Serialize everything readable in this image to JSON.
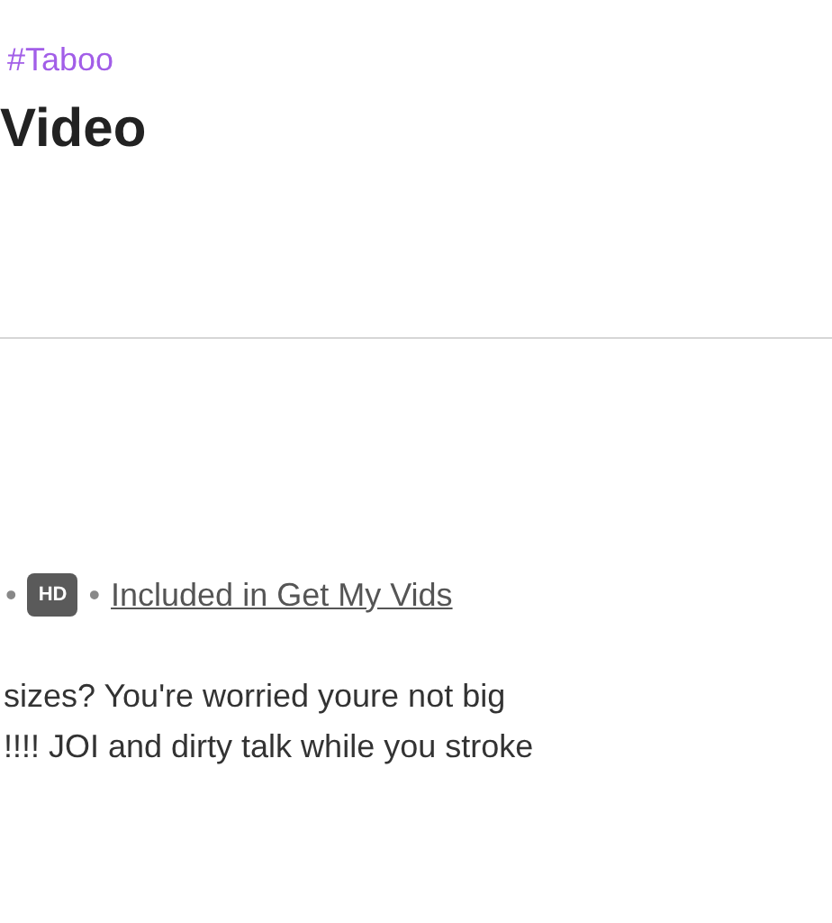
{
  "tag": "#Taboo",
  "title": "Video",
  "meta": {
    "separator": "•",
    "badge": "HD",
    "link": "Included in Get My Vids"
  },
  "description": [
    "sizes? You're worried youre not big",
    "!!!! JOI and dirty talk while you stroke"
  ]
}
